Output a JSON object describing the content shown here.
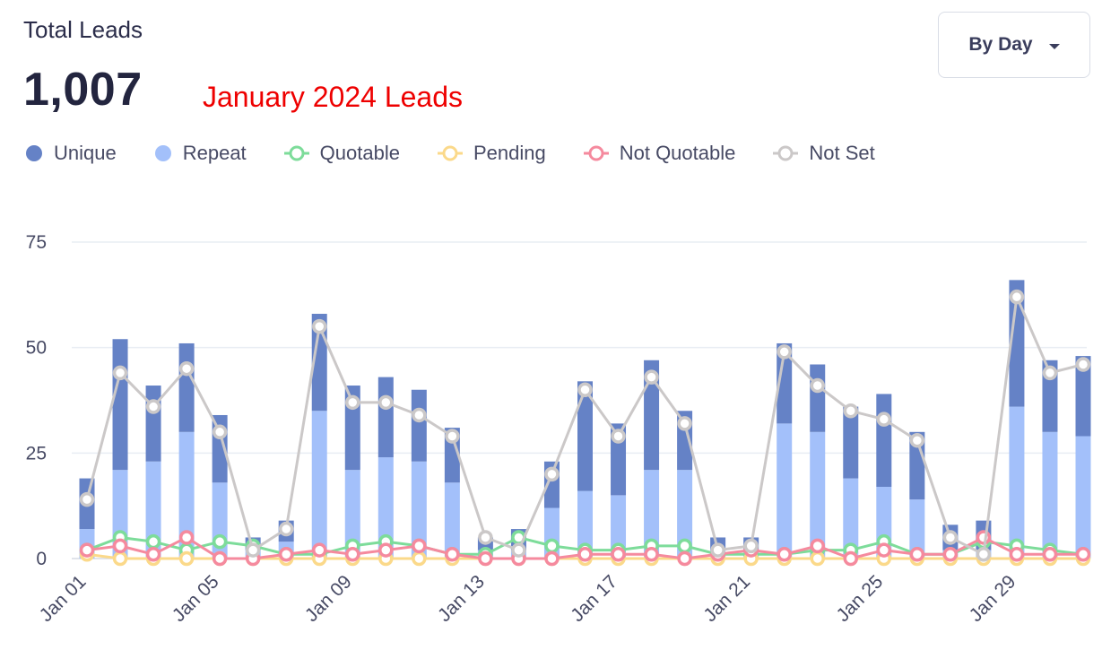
{
  "header": {
    "title": "Total Leads",
    "total": "1,007",
    "note": "January 2024 Leads"
  },
  "dropdown": {
    "label": "By Day",
    "icon": "caret-down-icon"
  },
  "chart_data": {
    "type": "bar",
    "title": "Total Leads",
    "stacked": true,
    "grid": true,
    "legend_position": "top-left",
    "ylim": [
      0,
      75
    ],
    "y_ticks": [
      0,
      25,
      50,
      75
    ],
    "x_tick_labels": [
      "Jan 01",
      "Jan 05",
      "Jan 09",
      "Jan 13",
      "Jan 17",
      "Jan 21",
      "Jan 25",
      "Jan 29"
    ],
    "categories": [
      "Jan 01",
      "Jan 02",
      "Jan 03",
      "Jan 04",
      "Jan 05",
      "Jan 06",
      "Jan 07",
      "Jan 08",
      "Jan 09",
      "Jan 10",
      "Jan 11",
      "Jan 12",
      "Jan 13",
      "Jan 14",
      "Jan 15",
      "Jan 16",
      "Jan 17",
      "Jan 18",
      "Jan 19",
      "Jan 20",
      "Jan 21",
      "Jan 22",
      "Jan 23",
      "Jan 24",
      "Jan 25",
      "Jan 26",
      "Jan 27",
      "Jan 28",
      "Jan 29",
      "Jan 30",
      "Jan 31"
    ],
    "bar_series": [
      {
        "name": "Repeat",
        "color": "#a3c0fa",
        "values": [
          7,
          21,
          23,
          30,
          18,
          2,
          4,
          35,
          21,
          24,
          23,
          18,
          2,
          2,
          12,
          16,
          15,
          21,
          21,
          2,
          2,
          32,
          30,
          19,
          17,
          14,
          2,
          2,
          36,
          30,
          29
        ]
      },
      {
        "name": "Unique",
        "color": "#6582c6",
        "values": [
          12,
          31,
          18,
          21,
          16,
          3,
          5,
          23,
          20,
          19,
          17,
          13,
          3,
          5,
          11,
          26,
          17,
          26,
          14,
          3,
          3,
          19,
          16,
          17,
          22,
          16,
          6,
          7,
          30,
          17,
          19
        ]
      }
    ],
    "line_series": [
      {
        "name": "Quotable",
        "color": "#7ddc9a",
        "values": [
          2,
          5,
          4,
          2,
          4,
          3,
          1,
          1,
          3,
          4,
          3,
          1,
          1,
          5,
          3,
          2,
          2,
          3,
          3,
          1,
          1,
          1,
          2,
          2,
          4,
          1,
          1,
          4,
          3,
          2,
          1
        ]
      },
      {
        "name": "Pending",
        "color": "#fbd98a",
        "values": [
          1,
          0,
          0,
          0,
          0,
          0,
          0,
          0,
          0,
          0,
          0,
          0,
          0,
          0,
          0,
          0,
          0,
          0,
          0,
          0,
          0,
          0,
          0,
          0,
          0,
          0,
          0,
          0,
          0,
          0,
          0
        ]
      },
      {
        "name": "Not Quotable",
        "color": "#f58a9e",
        "values": [
          2,
          3,
          1,
          5,
          0,
          0,
          1,
          2,
          1,
          2,
          3,
          1,
          0,
          0,
          0,
          1,
          1,
          1,
          0,
          1,
          2,
          1,
          3,
          0,
          2,
          1,
          1,
          5,
          1,
          1,
          1
        ]
      },
      {
        "name": "Not Set",
        "color": "#cbc8c8",
        "values": [
          14,
          44,
          36,
          45,
          30,
          2,
          7,
          55,
          37,
          37,
          34,
          29,
          5,
          2,
          20,
          40,
          29,
          43,
          32,
          2,
          3,
          49,
          41,
          35,
          33,
          28,
          5,
          1,
          62,
          44,
          46
        ]
      }
    ]
  },
  "legend": [
    {
      "label": "Unique",
      "marker": "dot",
      "color": "#6582c6"
    },
    {
      "label": "Repeat",
      "marker": "dot",
      "color": "#a3c0fa"
    },
    {
      "label": "Quotable",
      "marker": "line-circle",
      "color": "#7ddc9a"
    },
    {
      "label": "Pending",
      "marker": "line-circle",
      "color": "#fbd98a"
    },
    {
      "label": "Not Quotable",
      "marker": "line-circle",
      "color": "#f58a9e"
    },
    {
      "label": "Not Set",
      "marker": "line-circle",
      "color": "#cbc8c8"
    }
  ]
}
